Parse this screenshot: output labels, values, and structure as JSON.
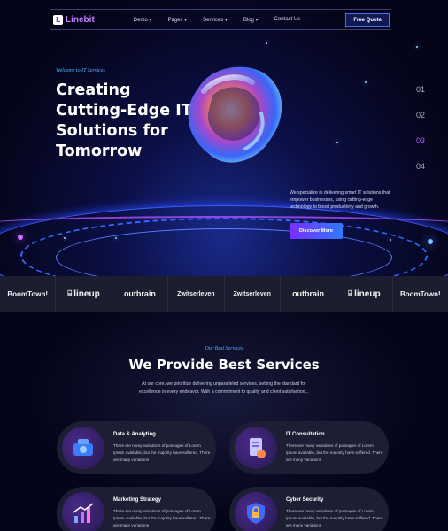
{
  "header": {
    "logo_text": "Linebit",
    "logo_mark": "L",
    "menu": [
      "Demo ▾",
      "Pages ▾",
      "Services ▾",
      "Blog ▾",
      "Contact Us"
    ],
    "cta_label": "Free Quote"
  },
  "hero": {
    "welcome": "Welcome to IT Services",
    "headline": "Creating Cutting-Edge IT Solutions for Tomorrow",
    "description": "We specialize in delivering smart IT solutions that empower businesses, using cutting-edge technology to boost productivity and growth.",
    "button_label": "Discover More",
    "steps": [
      "01",
      "02",
      "03",
      "04"
    ],
    "active_step": "03"
  },
  "brands": [
    "BoomTown!",
    "lineup",
    "outbrain",
    "Zwitserleven",
    "Zwitserleven",
    "outbrain",
    "lineup",
    "BoomTown!"
  ],
  "services": {
    "subtitle": "Our Best Services",
    "title": "We Provide Best Services",
    "description": "At our core, we prioritize delivering unparalleled services, setting the standard for excellence in every endeavor. With a commitment to quality and client satisfaction,..",
    "cards": [
      {
        "title": "Data & Analyting",
        "text": "There are many variations of passages of Lorem Ipsum available, but the majority have suffered. There are many variations",
        "icon": "data-analytics-icon"
      },
      {
        "title": "IT Consultation",
        "text": "There are many variations of passages of Lorem Ipsum available, but the majority have suffered. There are many variations",
        "icon": "consultation-icon"
      },
      {
        "title": "Marketing Strategy",
        "text": "There are many variations of passages of Lorem Ipsum available, but the majority have suffered. There are many variations",
        "icon": "marketing-chart-icon"
      },
      {
        "title": "Cyber Security",
        "text": "There are many variations of passages of Lorem Ipsum available, but the majority have suffered. There are many variations",
        "icon": "security-shield-icon"
      }
    ]
  },
  "colors": {
    "accent": "#7b2dff",
    "link_blue": "#4fb3ff",
    "background": "#05051a"
  }
}
